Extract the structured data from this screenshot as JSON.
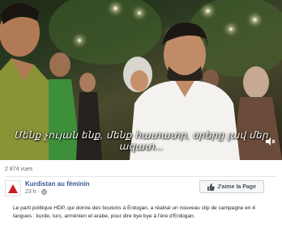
{
  "video": {
    "subtitle": "Մենք չույան ենք, մենք հատատր, օրերը լավ մեր ազատ..."
  },
  "post": {
    "views": "2 874 vues",
    "page_name": "Kurdistan au féminin",
    "time": "23 h",
    "privacy_icon": "globe-icon",
    "like_label": "J'aime la Page",
    "text": "Le parti politique HDP, qui donne des boutons à Erdogan, a réalisé un nouveau clip de campagne en 4 langues : kurde, turc, arménien et arabe, pour dire bye bye à l'ère d'Erdogan."
  },
  "colors": {
    "link": "#365899",
    "muted": "#606770",
    "avatar_accent": "#c91f2a"
  }
}
